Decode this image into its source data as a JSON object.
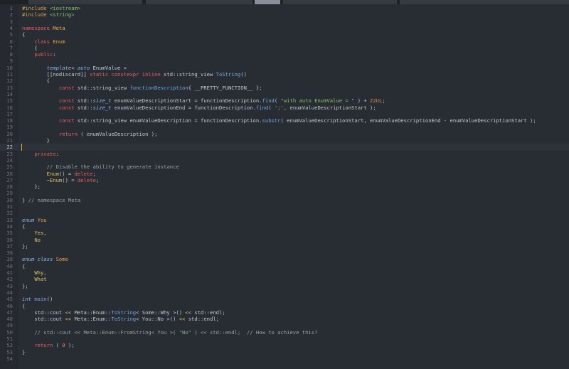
{
  "editor": {
    "lines": [
      [
        {
          "c": "pp",
          "t": "#include "
        },
        {
          "c": "s",
          "t": "<iostream>"
        }
      ],
      [
        {
          "c": "pp",
          "t": "#include "
        },
        {
          "c": "s",
          "t": "<string>"
        }
      ],
      [],
      [
        {
          "c": "k",
          "t": "namespace "
        },
        {
          "c": "ns",
          "t": "Meta"
        }
      ],
      [
        {
          "t": "{"
        }
      ],
      [
        {
          "t": "    "
        },
        {
          "c": "k",
          "t": "class "
        },
        {
          "c": "cl",
          "t": "Enum"
        }
      ],
      [
        {
          "t": "    {"
        }
      ],
      [
        {
          "t": "    "
        },
        {
          "c": "k",
          "t": "public"
        },
        {
          "t": ":"
        }
      ],
      [],
      [
        {
          "t": "        "
        },
        {
          "c": "t",
          "t": "template"
        },
        {
          "t": "< "
        },
        {
          "c": "t",
          "t": "auto"
        },
        {
          "t": " EnumValue >"
        }
      ],
      [
        {
          "t": "        [[nodiscard]] "
        },
        {
          "c": "k",
          "t": "static constexpr inline"
        },
        {
          "t": " std::string_view "
        },
        {
          "c": "fn",
          "t": "ToString"
        },
        {
          "t": "()"
        }
      ],
      [
        {
          "t": "        {"
        }
      ],
      [
        {
          "t": "            "
        },
        {
          "c": "k",
          "t": "const"
        },
        {
          "t": " std::string_view "
        },
        {
          "c": "fn",
          "t": "functionDescription"
        },
        {
          "t": "{ __PRETTY_FUNCTION__ };"
        }
      ],
      [],
      [
        {
          "t": "            "
        },
        {
          "c": "k",
          "t": "const"
        },
        {
          "t": " std::"
        },
        {
          "c": "t",
          "t": "size_t"
        },
        {
          "t": " enumValueDescriptionStart = functionDescription."
        },
        {
          "c": "fn",
          "t": "find"
        },
        {
          "t": "( "
        },
        {
          "c": "s",
          "t": "\"with auto EnumValue = \""
        },
        {
          "t": " ) + "
        },
        {
          "c": "n",
          "t": "22UL"
        },
        {
          "t": ";"
        }
      ],
      [
        {
          "t": "            "
        },
        {
          "c": "k",
          "t": "const"
        },
        {
          "t": " std::"
        },
        {
          "c": "t",
          "t": "size_t"
        },
        {
          "t": " enumValueDescriptionEnd = functionDescription."
        },
        {
          "c": "fn",
          "t": "find"
        },
        {
          "t": "( "
        },
        {
          "c": "s",
          "t": "';'"
        },
        {
          "t": ", enumValueDescriptionStart );"
        }
      ],
      [],
      [
        {
          "t": "            "
        },
        {
          "c": "k",
          "t": "const"
        },
        {
          "t": " std::string_view enumValueDescription = functionDescription."
        },
        {
          "c": "fn",
          "t": "substr"
        },
        {
          "t": "( enumValueDescriptionStart, enumValueDescriptionEnd - enumValueDescriptionStart );"
        }
      ],
      [],
      [
        {
          "t": "            "
        },
        {
          "c": "k",
          "t": "return"
        },
        {
          "t": " ( enumValueDescription );"
        }
      ],
      [
        {
          "t": "        }"
        }
      ],
      [],
      [
        {
          "t": "    "
        },
        {
          "c": "k",
          "t": "private"
        },
        {
          "t": ":"
        }
      ],
      [],
      [
        {
          "t": "        "
        },
        {
          "c": "c",
          "t": "// Disable the ability to generate instance"
        }
      ],
      [
        {
          "t": "        "
        },
        {
          "c": "ec",
          "t": "Enum"
        },
        {
          "t": "() = "
        },
        {
          "c": "k",
          "t": "delete"
        },
        {
          "t": ";"
        }
      ],
      [
        {
          "t": "        ~"
        },
        {
          "c": "ec",
          "t": "Enum"
        },
        {
          "t": "() = "
        },
        {
          "c": "k",
          "t": "delete"
        },
        {
          "t": ";"
        }
      ],
      [
        {
          "t": "    };"
        }
      ],
      [],
      [
        {
          "t": "} "
        },
        {
          "c": "c",
          "t": "// namespace Meta"
        }
      ],
      [],
      [],
      [
        {
          "c": "t",
          "t": "enum "
        },
        {
          "c": "cl",
          "t": "You"
        }
      ],
      [
        {
          "t": "{"
        }
      ],
      [
        {
          "t": "    "
        },
        {
          "c": "ec",
          "t": "Yes"
        },
        {
          "t": ","
        }
      ],
      [
        {
          "t": "    "
        },
        {
          "c": "ec",
          "t": "No"
        }
      ],
      [
        {
          "t": "};"
        }
      ],
      [],
      [
        {
          "c": "t",
          "t": "enum class "
        },
        {
          "c": "cl",
          "t": "Some"
        }
      ],
      [
        {
          "t": "{"
        }
      ],
      [
        {
          "t": "    "
        },
        {
          "c": "ec",
          "t": "Why"
        },
        {
          "t": ","
        }
      ],
      [
        {
          "t": "    "
        },
        {
          "c": "ec",
          "t": "What"
        }
      ],
      [
        {
          "t": "};"
        }
      ],
      [],
      [
        {
          "c": "t",
          "t": "int"
        },
        {
          "t": " "
        },
        {
          "c": "fn",
          "t": "main"
        },
        {
          "t": "()"
        }
      ],
      [
        {
          "t": "{"
        }
      ],
      [
        {
          "t": "    std::cout "
        },
        {
          "c": "op",
          "t": "<<"
        },
        {
          "t": " Meta::Enum::"
        },
        {
          "c": "fn",
          "t": "ToString"
        },
        {
          "t": "< Some::Why >() "
        },
        {
          "c": "op",
          "t": "<<"
        },
        {
          "t": " std::endl;"
        }
      ],
      [
        {
          "t": "    std::cout "
        },
        {
          "c": "op",
          "t": "<<"
        },
        {
          "t": " Meta::Enum::"
        },
        {
          "c": "fn",
          "t": "ToString"
        },
        {
          "t": "< You::No >() "
        },
        {
          "c": "op",
          "t": "<<"
        },
        {
          "t": " std::endl;"
        }
      ],
      [],
      [
        {
          "t": "    "
        },
        {
          "c": "c",
          "t": "// std::cout << Meta::Enum::FromString< You >( \"No\" ) << std::endl;  // How to achieve this?"
        }
      ],
      [],
      [
        {
          "t": "    "
        },
        {
          "c": "k",
          "t": "return"
        },
        {
          "t": " ( "
        },
        {
          "c": "n",
          "t": "0"
        },
        {
          "t": " );"
        }
      ],
      [
        {
          "t": "}"
        }
      ],
      []
    ]
  }
}
